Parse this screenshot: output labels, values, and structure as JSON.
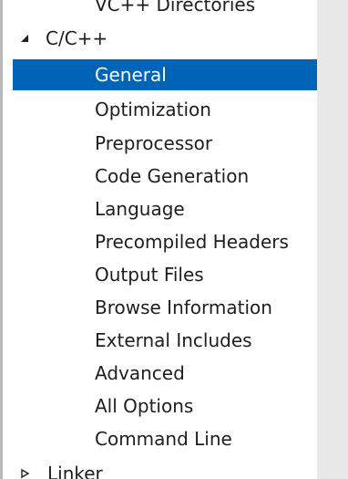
{
  "tree": {
    "previous_item": "VC++ Directories",
    "group": {
      "label": "C/C++",
      "expanded_icon": "expanded-triangle-icon"
    },
    "items": [
      {
        "label": "General",
        "selected": true
      },
      {
        "label": "Optimization"
      },
      {
        "label": "Preprocessor"
      },
      {
        "label": "Code Generation"
      },
      {
        "label": "Language"
      },
      {
        "label": "Precompiled Headers"
      },
      {
        "label": "Output Files"
      },
      {
        "label": "Browse Information"
      },
      {
        "label": "External Includes"
      },
      {
        "label": "Advanced"
      },
      {
        "label": "All Options"
      },
      {
        "label": "Command Line"
      }
    ],
    "next_group": {
      "label": "Linker",
      "collapsed_icon": "collapsed-triangle-icon"
    }
  },
  "colors": {
    "selection": "#0064b6",
    "text": "#1e1e1e",
    "scrollbar": "#e8e8e8"
  }
}
